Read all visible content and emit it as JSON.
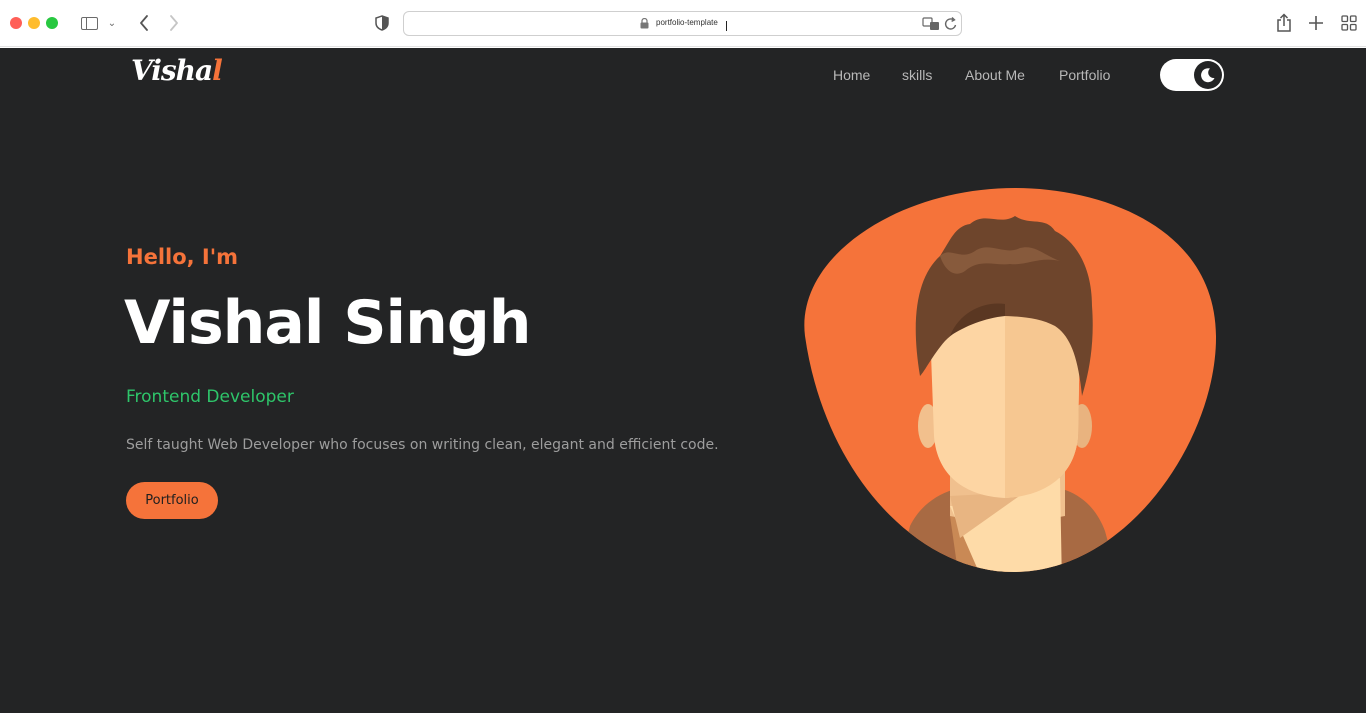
{
  "browser": {
    "url": "portfolio-template"
  },
  "header": {
    "logo_main": "Visha",
    "logo_accent": "l",
    "nav": [
      {
        "label": "Home"
      },
      {
        "label": "skills"
      },
      {
        "label": "About Me"
      },
      {
        "label": "Portfolio"
      }
    ],
    "theme_toggle": {
      "state": "dark"
    }
  },
  "hero": {
    "greeting": "Hello, I'm",
    "name": "Vishal Singh",
    "role": "Frontend Developer",
    "description": "Self taught Web Developer who focuses on writing clean, elegant and efficient code.",
    "cta_label": "Portfolio"
  },
  "colors": {
    "background": "#232425",
    "accent": "#f5733a",
    "role": "#2ec56a",
    "muted_text": "#9d9d9d",
    "nav_text": "#b8b8b8"
  }
}
